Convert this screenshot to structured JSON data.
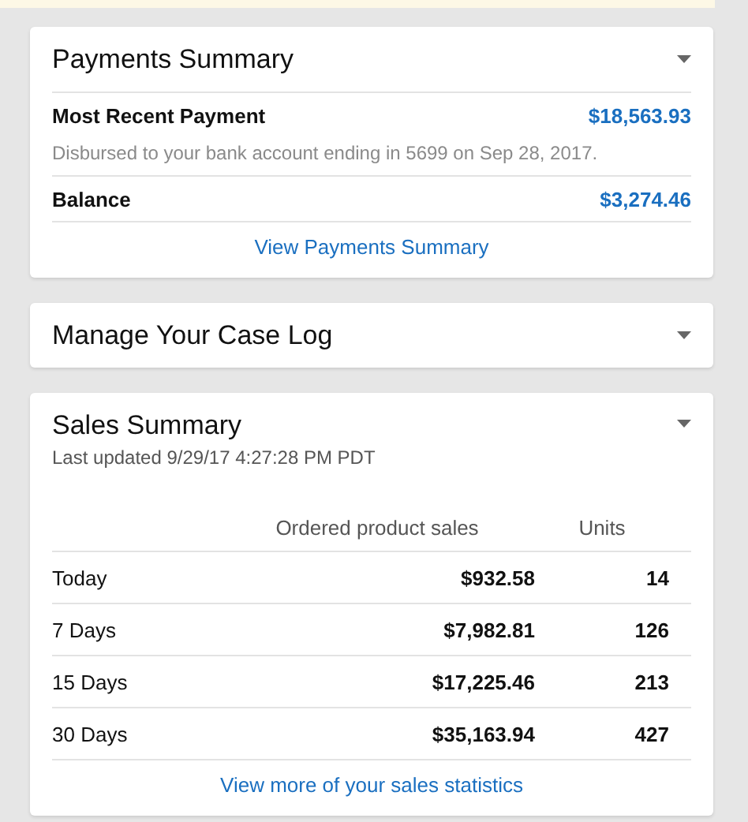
{
  "payments_summary": {
    "title": "Payments Summary",
    "expanded": true,
    "most_recent_payment": {
      "label": "Most Recent Payment",
      "amount": "$18,563.93",
      "note": "Disbursed to your bank account ending in 5699 on Sep 28, 2017."
    },
    "balance": {
      "label": "Balance",
      "amount": "$3,274.46"
    },
    "link": "View Payments Summary"
  },
  "case_log": {
    "title": "Manage Your Case Log",
    "expanded": false
  },
  "sales_summary": {
    "title": "Sales Summary",
    "expanded": true,
    "last_updated": "Last updated 9/29/17 4:27:28 PM PDT",
    "columns": [
      "Ordered product sales",
      "Units"
    ],
    "rows": [
      {
        "period": "Today",
        "sales": "$932.58",
        "units": "14"
      },
      {
        "period": "7 Days",
        "sales": "$7,982.81",
        "units": "126"
      },
      {
        "period": "15 Days",
        "sales": "$17,225.46",
        "units": "213"
      },
      {
        "period": "30 Days",
        "sales": "$35,163.94",
        "units": "427"
      }
    ],
    "link": "View more of your sales statistics"
  }
}
